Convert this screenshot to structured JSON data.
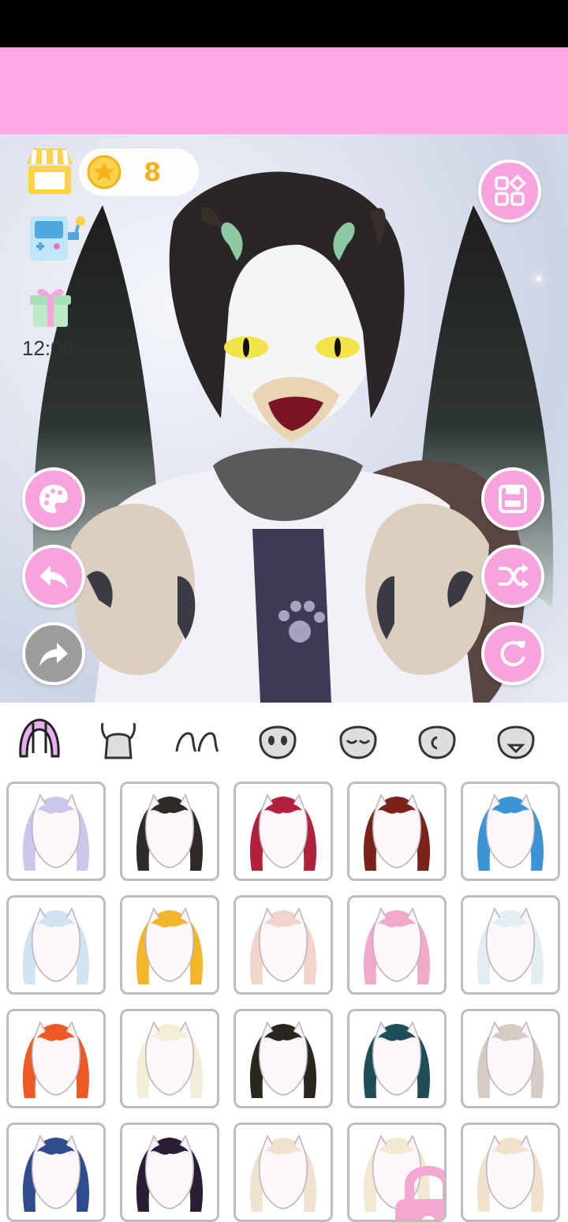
{
  "hud": {
    "coins": "8",
    "clock": "12:06"
  },
  "colors": {
    "accent_pink": "#f7a4de",
    "banner_pink": "#ffa8e3",
    "coin_gold": "#f1b21c",
    "disabled_grey": "#9c9c9c"
  },
  "left_buttons": [
    {
      "name": "palette-button",
      "icon": "palette-icon"
    },
    {
      "name": "undo-button",
      "icon": "undo-arrow-icon"
    },
    {
      "name": "redo-button",
      "icon": "redo-arrow-icon",
      "disabled": true
    }
  ],
  "right_buttons": [
    {
      "name": "menu-button",
      "icon": "grid-menu-icon"
    },
    {
      "name": "save-button",
      "icon": "save-icon"
    },
    {
      "name": "randomize-button",
      "icon": "shuffle-icon"
    },
    {
      "name": "reset-button",
      "icon": "refresh-icon"
    }
  ],
  "category_tabs": [
    {
      "name": "tab-hair",
      "icon": "hair-icon",
      "selected": true
    },
    {
      "name": "tab-horns",
      "icon": "horns-icon"
    },
    {
      "name": "tab-ears",
      "icon": "ears-icon"
    },
    {
      "name": "tab-face-eyes",
      "icon": "face-eyes-icon"
    },
    {
      "name": "tab-face-closed-eyes",
      "icon": "face-closed-eyes-icon"
    },
    {
      "name": "tab-face-side",
      "icon": "face-side-icon"
    },
    {
      "name": "tab-face-mouth",
      "icon": "face-mouth-icon"
    }
  ],
  "hair_options": [
    {
      "color": "#c9c8ea"
    },
    {
      "color": "#2d2a28"
    },
    {
      "color": "#b2203b"
    },
    {
      "color": "#7b2318"
    },
    {
      "color": "#3a95d6"
    },
    {
      "color": "#cfe3f3"
    },
    {
      "color": "#f2b628"
    },
    {
      "color": "#f1d4cc"
    },
    {
      "color": "#f0a9c8"
    },
    {
      "color": "#e3eef2"
    },
    {
      "color": "#ef5a24"
    },
    {
      "color": "#f2eed8"
    },
    {
      "color": "#2a2620"
    },
    {
      "color": "#1f4e58"
    },
    {
      "color": "#d6ccc5"
    },
    {
      "color": "#2f4c8c"
    },
    {
      "color": "#2a1d35"
    },
    {
      "color": "#efe3cf"
    },
    {
      "color": "#f3e9d2",
      "locked": true
    },
    {
      "color": "#f2e2cc"
    }
  ]
}
